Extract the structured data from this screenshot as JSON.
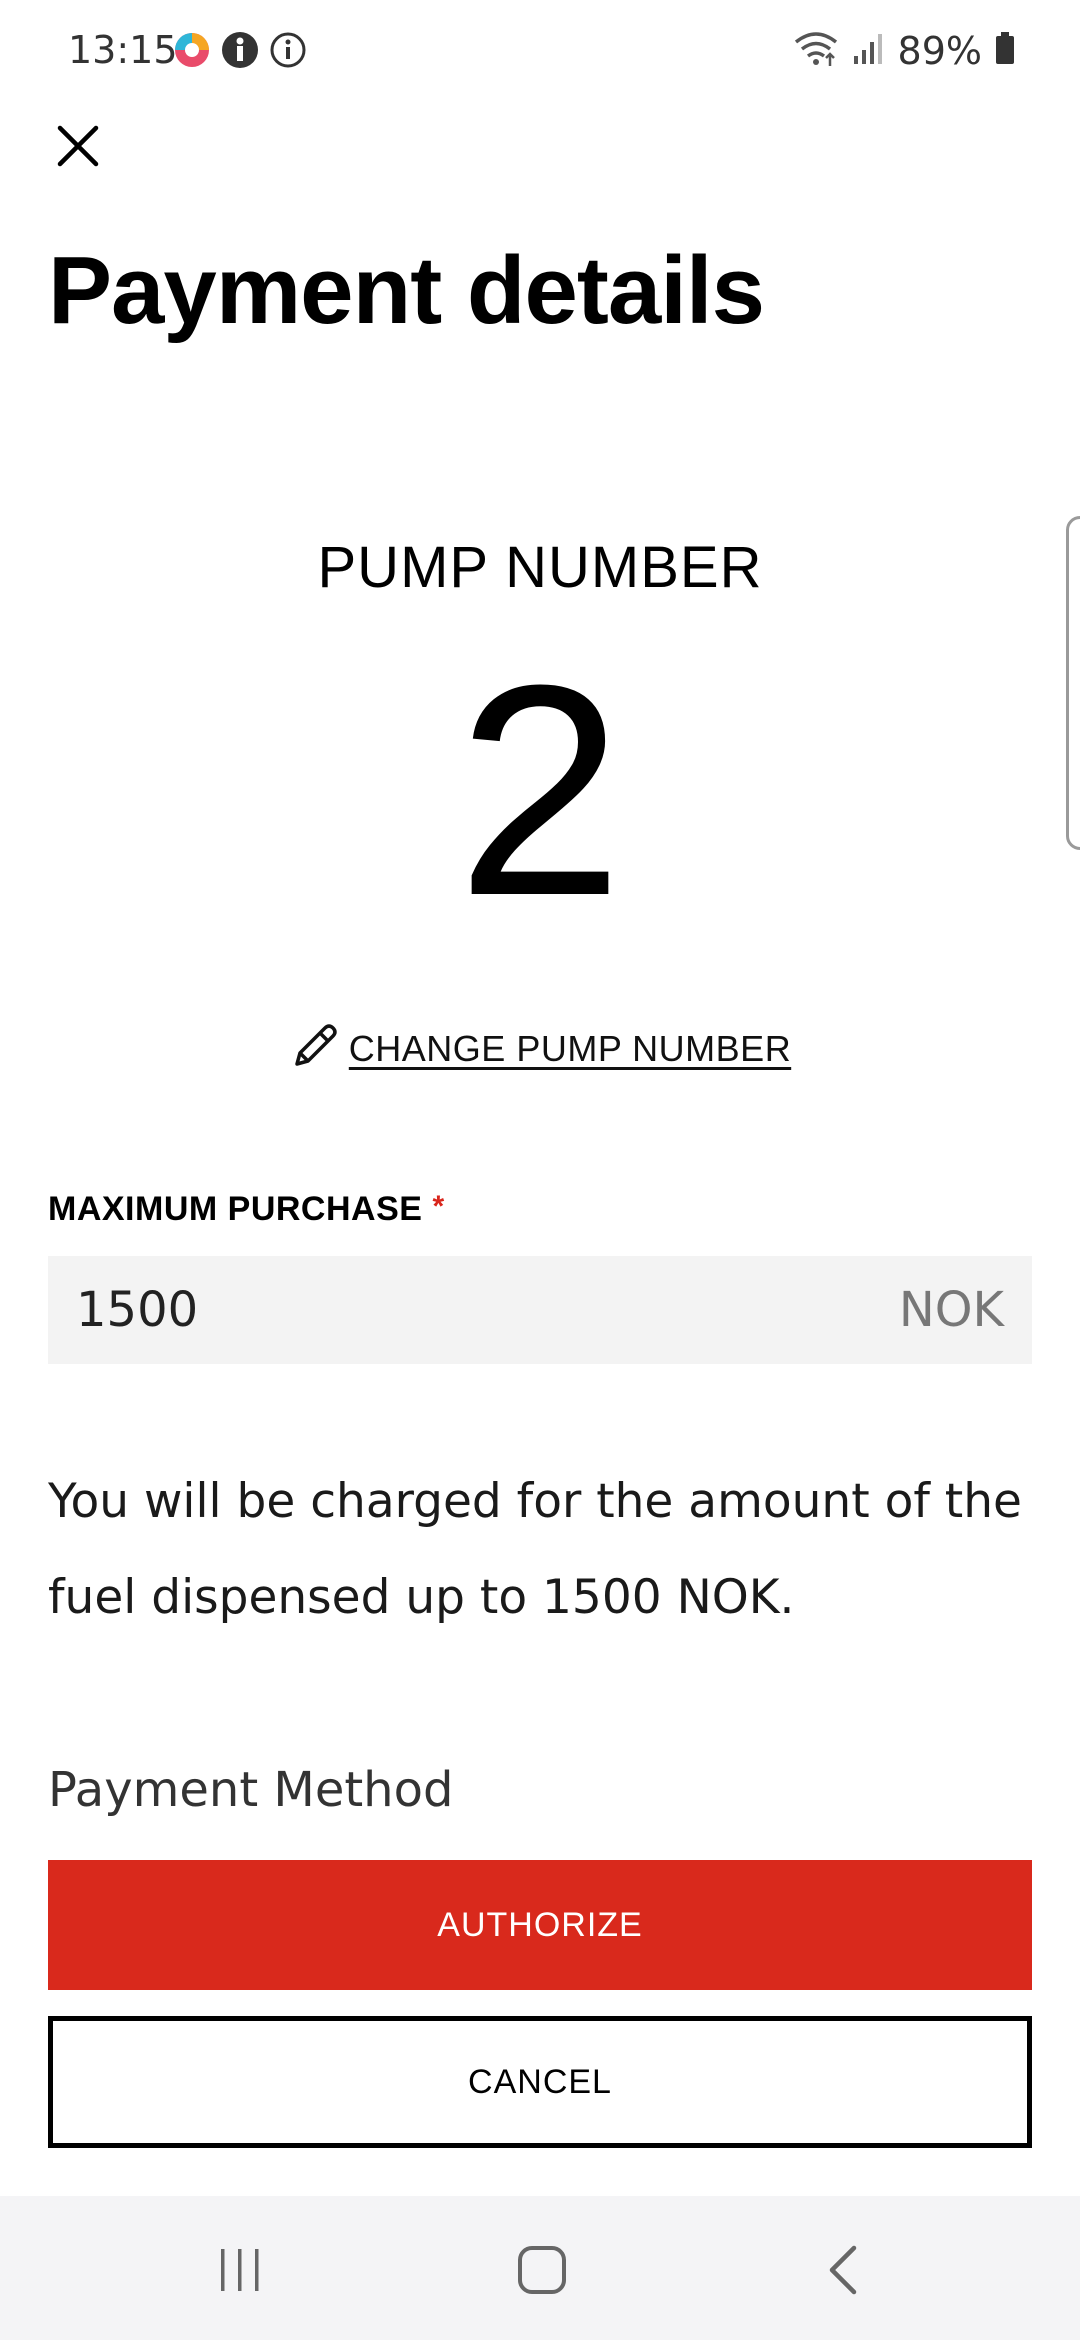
{
  "status_bar": {
    "time": "13:15",
    "battery": "89%",
    "icons": [
      "app-notification-icon",
      "info-filled-icon",
      "info-outline-icon",
      "wifi-icon",
      "signal-icon",
      "battery-icon"
    ]
  },
  "header": {
    "close_icon": "close-icon",
    "title": "Payment details"
  },
  "pump": {
    "label": "PUMP NUMBER",
    "value": "2",
    "change_label": "CHANGE PUMP NUMBER",
    "change_icon": "pencil-icon"
  },
  "max_purchase": {
    "label": "MAXIMUM PURCHASE",
    "required_marker": "*",
    "value": "1500",
    "currency": "NOK"
  },
  "info_text": "You will be charged for the amount of the fuel dispensed up to 1500 NOK.",
  "payment_method_label": "Payment Method",
  "actions": {
    "authorize": "AUTHORIZE",
    "cancel": "CANCEL"
  },
  "nav_bar": {
    "icons": [
      "recent-apps-icon",
      "home-icon",
      "back-icon"
    ]
  },
  "colors": {
    "accent": "#d9291c",
    "field_bg": "#f3f3f3",
    "nav_bg": "#f4f4f6"
  }
}
